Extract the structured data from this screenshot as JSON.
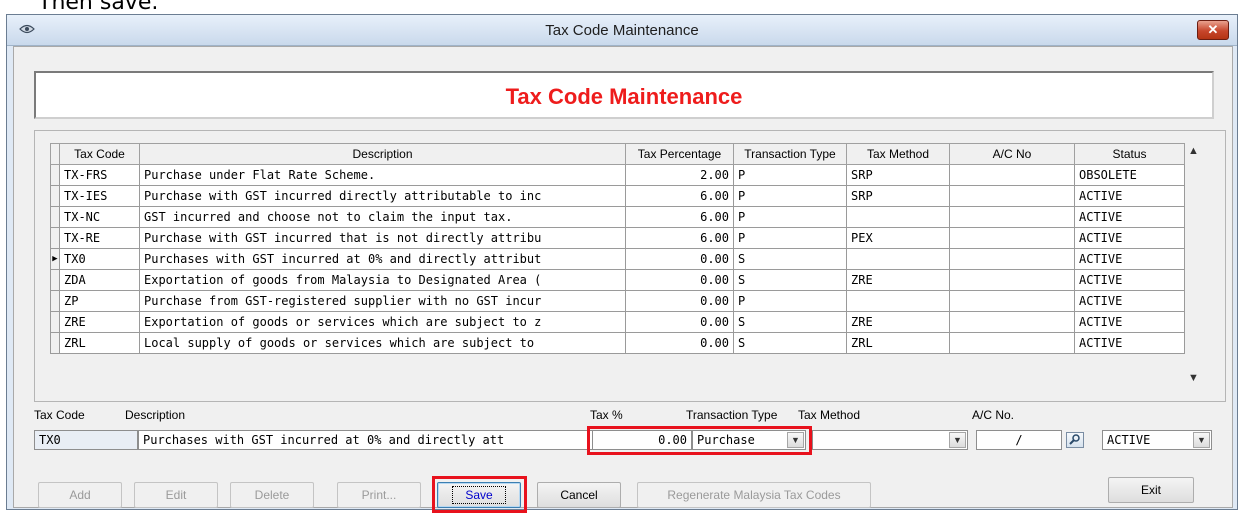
{
  "pre_text": "Then save.",
  "window": {
    "title": "Tax Code Maintenance",
    "close_glyph": "✕",
    "heading": "Tax Code Maintenance"
  },
  "grid": {
    "columns": [
      "Tax Code",
      "Description",
      "Tax Percentage",
      "Transaction Type",
      "Tax Method",
      "A/C No",
      "Status"
    ],
    "current_row_marker": "▶",
    "rows": [
      {
        "code": "TX-FRS",
        "description": "Purchase under Flat Rate Scheme.",
        "percentage": "2.00",
        "type": "P",
        "method": "SRP",
        "acno": "",
        "status": "OBSOLETE"
      },
      {
        "code": "TX-IES",
        "description": "Purchase with GST incurred directly attributable to inc",
        "percentage": "6.00",
        "type": "P",
        "method": "SRP",
        "acno": "",
        "status": "ACTIVE"
      },
      {
        "code": "TX-NC",
        "description": "GST incurred and choose not to claim the input tax.",
        "percentage": "6.00",
        "type": "P",
        "method": "",
        "acno": "",
        "status": "ACTIVE"
      },
      {
        "code": "TX-RE",
        "description": "Purchase with GST incurred that is not directly attribu",
        "percentage": "6.00",
        "type": "P",
        "method": "PEX",
        "acno": "",
        "status": "ACTIVE"
      },
      {
        "code": "TX0",
        "description": "Purchases with GST incurred at 0% and directly attribut",
        "percentage": "0.00",
        "type": "S",
        "method": "",
        "acno": "",
        "status": "ACTIVE"
      },
      {
        "code": "ZDA",
        "description": "Exportation of goods from Malaysia to Designated Area (",
        "percentage": "0.00",
        "type": "S",
        "method": "ZRE",
        "acno": "",
        "status": "ACTIVE"
      },
      {
        "code": "ZP",
        "description": "Purchase from GST-registered supplier with no GST incur",
        "percentage": "0.00",
        "type": "P",
        "method": "",
        "acno": "",
        "status": "ACTIVE"
      },
      {
        "code": "ZRE",
        "description": "Exportation of goods or services which are subject to z",
        "percentage": "0.00",
        "type": "S",
        "method": "ZRE",
        "acno": "",
        "status": "ACTIVE"
      },
      {
        "code": "ZRL",
        "description": "Local supply of goods or services which are subject to",
        "percentage": "0.00",
        "type": "S",
        "method": "ZRL",
        "acno": "",
        "status": "ACTIVE"
      }
    ]
  },
  "form": {
    "labels": {
      "tax_code": "Tax Code",
      "description": "Description",
      "tax_pct": "Tax %",
      "transaction_type": "Transaction Type",
      "tax_method": "Tax Method",
      "acno": "A/C No."
    },
    "values": {
      "tax_code": "TX0",
      "description": "Purchases with GST incurred at 0% and directly att",
      "tax_pct": "0.00",
      "transaction_type": "Purchase",
      "tax_method": "",
      "acno": "/",
      "status": "ACTIVE"
    }
  },
  "buttons": {
    "add": "Add",
    "edit": "Edit",
    "delete": "Delete",
    "print": "Print...",
    "save": "Save",
    "cancel": "Cancel",
    "regenerate": "Regenerate Malaysia Tax Codes",
    "exit": "Exit"
  },
  "colors": {
    "heading_red": "#ee1c1c",
    "highlight_red": "#e8121d"
  }
}
